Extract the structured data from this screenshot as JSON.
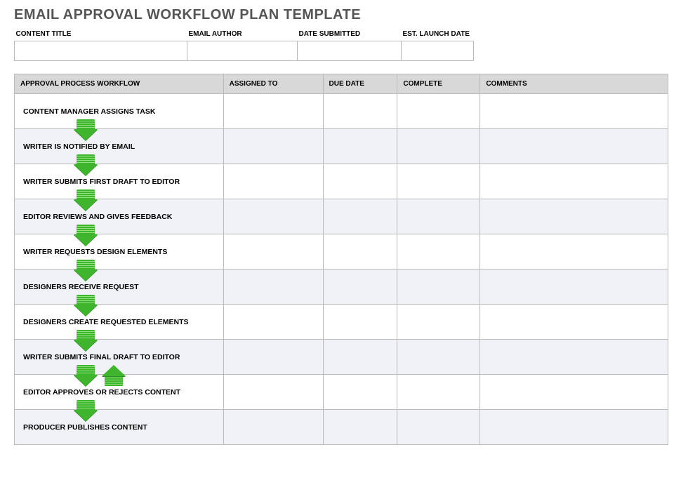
{
  "title": "EMAIL APPROVAL WORKFLOW PLAN TEMPLATE",
  "meta": {
    "headers": [
      "CONTENT TITLE",
      "EMAIL AUTHOR",
      "DATE SUBMITTED",
      "EST. LAUNCH DATE"
    ],
    "values": [
      "",
      "",
      "",
      ""
    ]
  },
  "workflow": {
    "headers": [
      "APPROVAL PROCESS WORKFLOW",
      "ASSIGNED TO",
      "DUE DATE",
      "COMPLETE",
      "COMMENTS"
    ],
    "steps": [
      {
        "label": "CONTENT MANAGER ASSIGNS TASK",
        "assigned": "",
        "due": "",
        "complete": "",
        "comments": "",
        "alt": false,
        "arrowDown": true,
        "arrowUp": false
      },
      {
        "label": "WRITER IS NOTIFIED BY EMAIL",
        "assigned": "",
        "due": "",
        "complete": "",
        "comments": "",
        "alt": true,
        "arrowDown": true,
        "arrowUp": false
      },
      {
        "label": "WRITER SUBMITS FIRST DRAFT TO EDITOR",
        "assigned": "",
        "due": "",
        "complete": "",
        "comments": "",
        "alt": false,
        "arrowDown": true,
        "arrowUp": false
      },
      {
        "label": "EDITOR REVIEWS AND GIVES FEEDBACK",
        "assigned": "",
        "due": "",
        "complete": "",
        "comments": "",
        "alt": true,
        "arrowDown": true,
        "arrowUp": false
      },
      {
        "label": "WRITER REQUESTS DESIGN ELEMENTS",
        "assigned": "",
        "due": "",
        "complete": "",
        "comments": "",
        "alt": false,
        "arrowDown": true,
        "arrowUp": false
      },
      {
        "label": "DESIGNERS RECEIVE REQUEST",
        "assigned": "",
        "due": "",
        "complete": "",
        "comments": "",
        "alt": true,
        "arrowDown": true,
        "arrowUp": false
      },
      {
        "label": "DESIGNERS CREATE REQUESTED ELEMENTS",
        "assigned": "",
        "due": "",
        "complete": "",
        "comments": "",
        "alt": false,
        "arrowDown": true,
        "arrowUp": false
      },
      {
        "label": "WRITER SUBMITS FINAL DRAFT TO EDITOR",
        "assigned": "",
        "due": "",
        "complete": "",
        "comments": "",
        "alt": true,
        "arrowDown": true,
        "arrowUp": true
      },
      {
        "label": "EDITOR APPROVES OR REJECTS CONTENT",
        "assigned": "",
        "due": "",
        "complete": "",
        "comments": "",
        "alt": false,
        "arrowDown": true,
        "arrowUp": false
      },
      {
        "label": "PRODUCER PUBLISHES CONTENT",
        "assigned": "",
        "due": "",
        "complete": "",
        "comments": "",
        "alt": true,
        "arrowDown": false,
        "arrowUp": false
      }
    ]
  }
}
